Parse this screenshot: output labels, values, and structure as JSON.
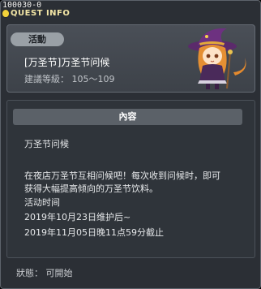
{
  "quest_id": "100030-0",
  "window_title": "QUEST INFO",
  "category_badge": "活動",
  "quest_name": "[万圣节]万圣节问候",
  "level_requirement": "建議等級： 105～109",
  "content_header": "內容",
  "content_lines": [
    "万圣节问候",
    "在夜店万圣节互相问候吧！每次收到问候时，即可",
    "获得大幅提高倾向的万圣节饮料。",
    "活动时间",
    "2019年10月23日维护后~",
    "2019年11月05日晚11点59分截止"
  ],
  "status": "狀態： 可開始",
  "icons": {
    "bulb": "quest-bulb-icon",
    "character": "witch-girl-portrait"
  },
  "colors": {
    "title": "#f3e6a6",
    "badge": "#9aa0a6",
    "panel": "#2b2f35"
  }
}
